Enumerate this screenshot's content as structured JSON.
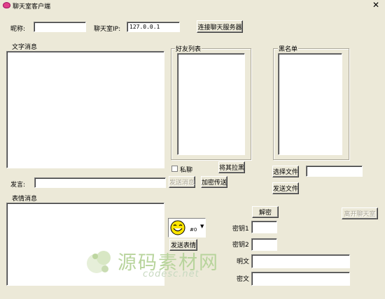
{
  "window": {
    "title": "聊天室客户端"
  },
  "labels": {
    "nickname": "昵称:",
    "server_ip": "聊天室IP:",
    "text_messages": "文字消息",
    "friends_list": "好友列表",
    "blacklist": "黑名单",
    "speak": "发言:",
    "private_chat": "私聊",
    "emoticon_messages": "表情消息",
    "key1": "密钥1",
    "key2": "密钥2",
    "plaintext": "明文",
    "ciphertext": "密文"
  },
  "inputs": {
    "nickname": "",
    "server_ip": "127.0.0.1",
    "message": "",
    "file_path": "",
    "key1": "",
    "key2": "",
    "plaintext": "",
    "ciphertext": ""
  },
  "buttons": {
    "connect": "连接聊天服务器",
    "blacklist_add": "将其拉黑",
    "send_message": "发送消息",
    "encrypt_send": "加密传送",
    "choose_file": "选择文件",
    "send_file": "发送文件",
    "decrypt": "解密",
    "leave_chat": "离开聊天室",
    "send_emoticon": "发送表情"
  },
  "emoticon": {
    "selected": "#0"
  },
  "watermark": {
    "cn": "源码素材网",
    "en": "codesc.net"
  }
}
